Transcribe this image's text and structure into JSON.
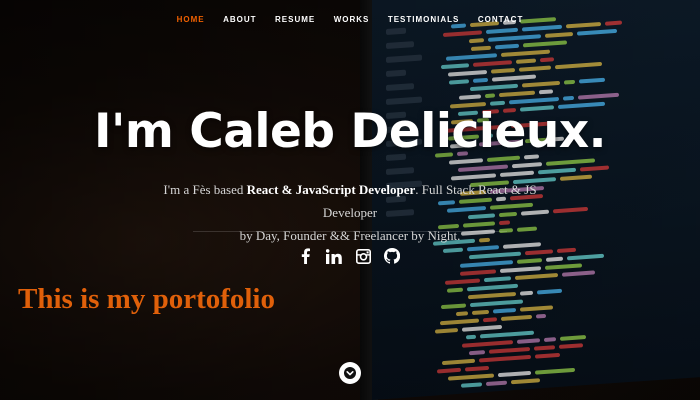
{
  "nav": {
    "items": [
      {
        "label": "HOME",
        "active": true
      },
      {
        "label": "ABOUT",
        "active": false
      },
      {
        "label": "RESUME",
        "active": false
      },
      {
        "label": "WORKS",
        "active": false
      },
      {
        "label": "TESTIMONIALS",
        "active": false
      },
      {
        "label": "CONTACT",
        "active": false
      }
    ],
    "active_color": "#f06000"
  },
  "hero": {
    "headline": "I'm Caleb Delicieux.",
    "intro": {
      "part1": "I'm a Fès based ",
      "role": "React & JavaScript Developer",
      "part2": ". Full Stack React & JS Developer",
      "line2": "by Day, Founder && Freelancer by Night."
    }
  },
  "social": [
    {
      "icon": "facebook-icon"
    },
    {
      "icon": "linkedin-icon"
    },
    {
      "icon": "instagram-icon"
    },
    {
      "icon": "github-icon"
    }
  ],
  "overlay_text": "This is my portofolio",
  "overlay_color": "#e0600a",
  "scroll_down": {
    "icon": "chevron-down-icon"
  }
}
